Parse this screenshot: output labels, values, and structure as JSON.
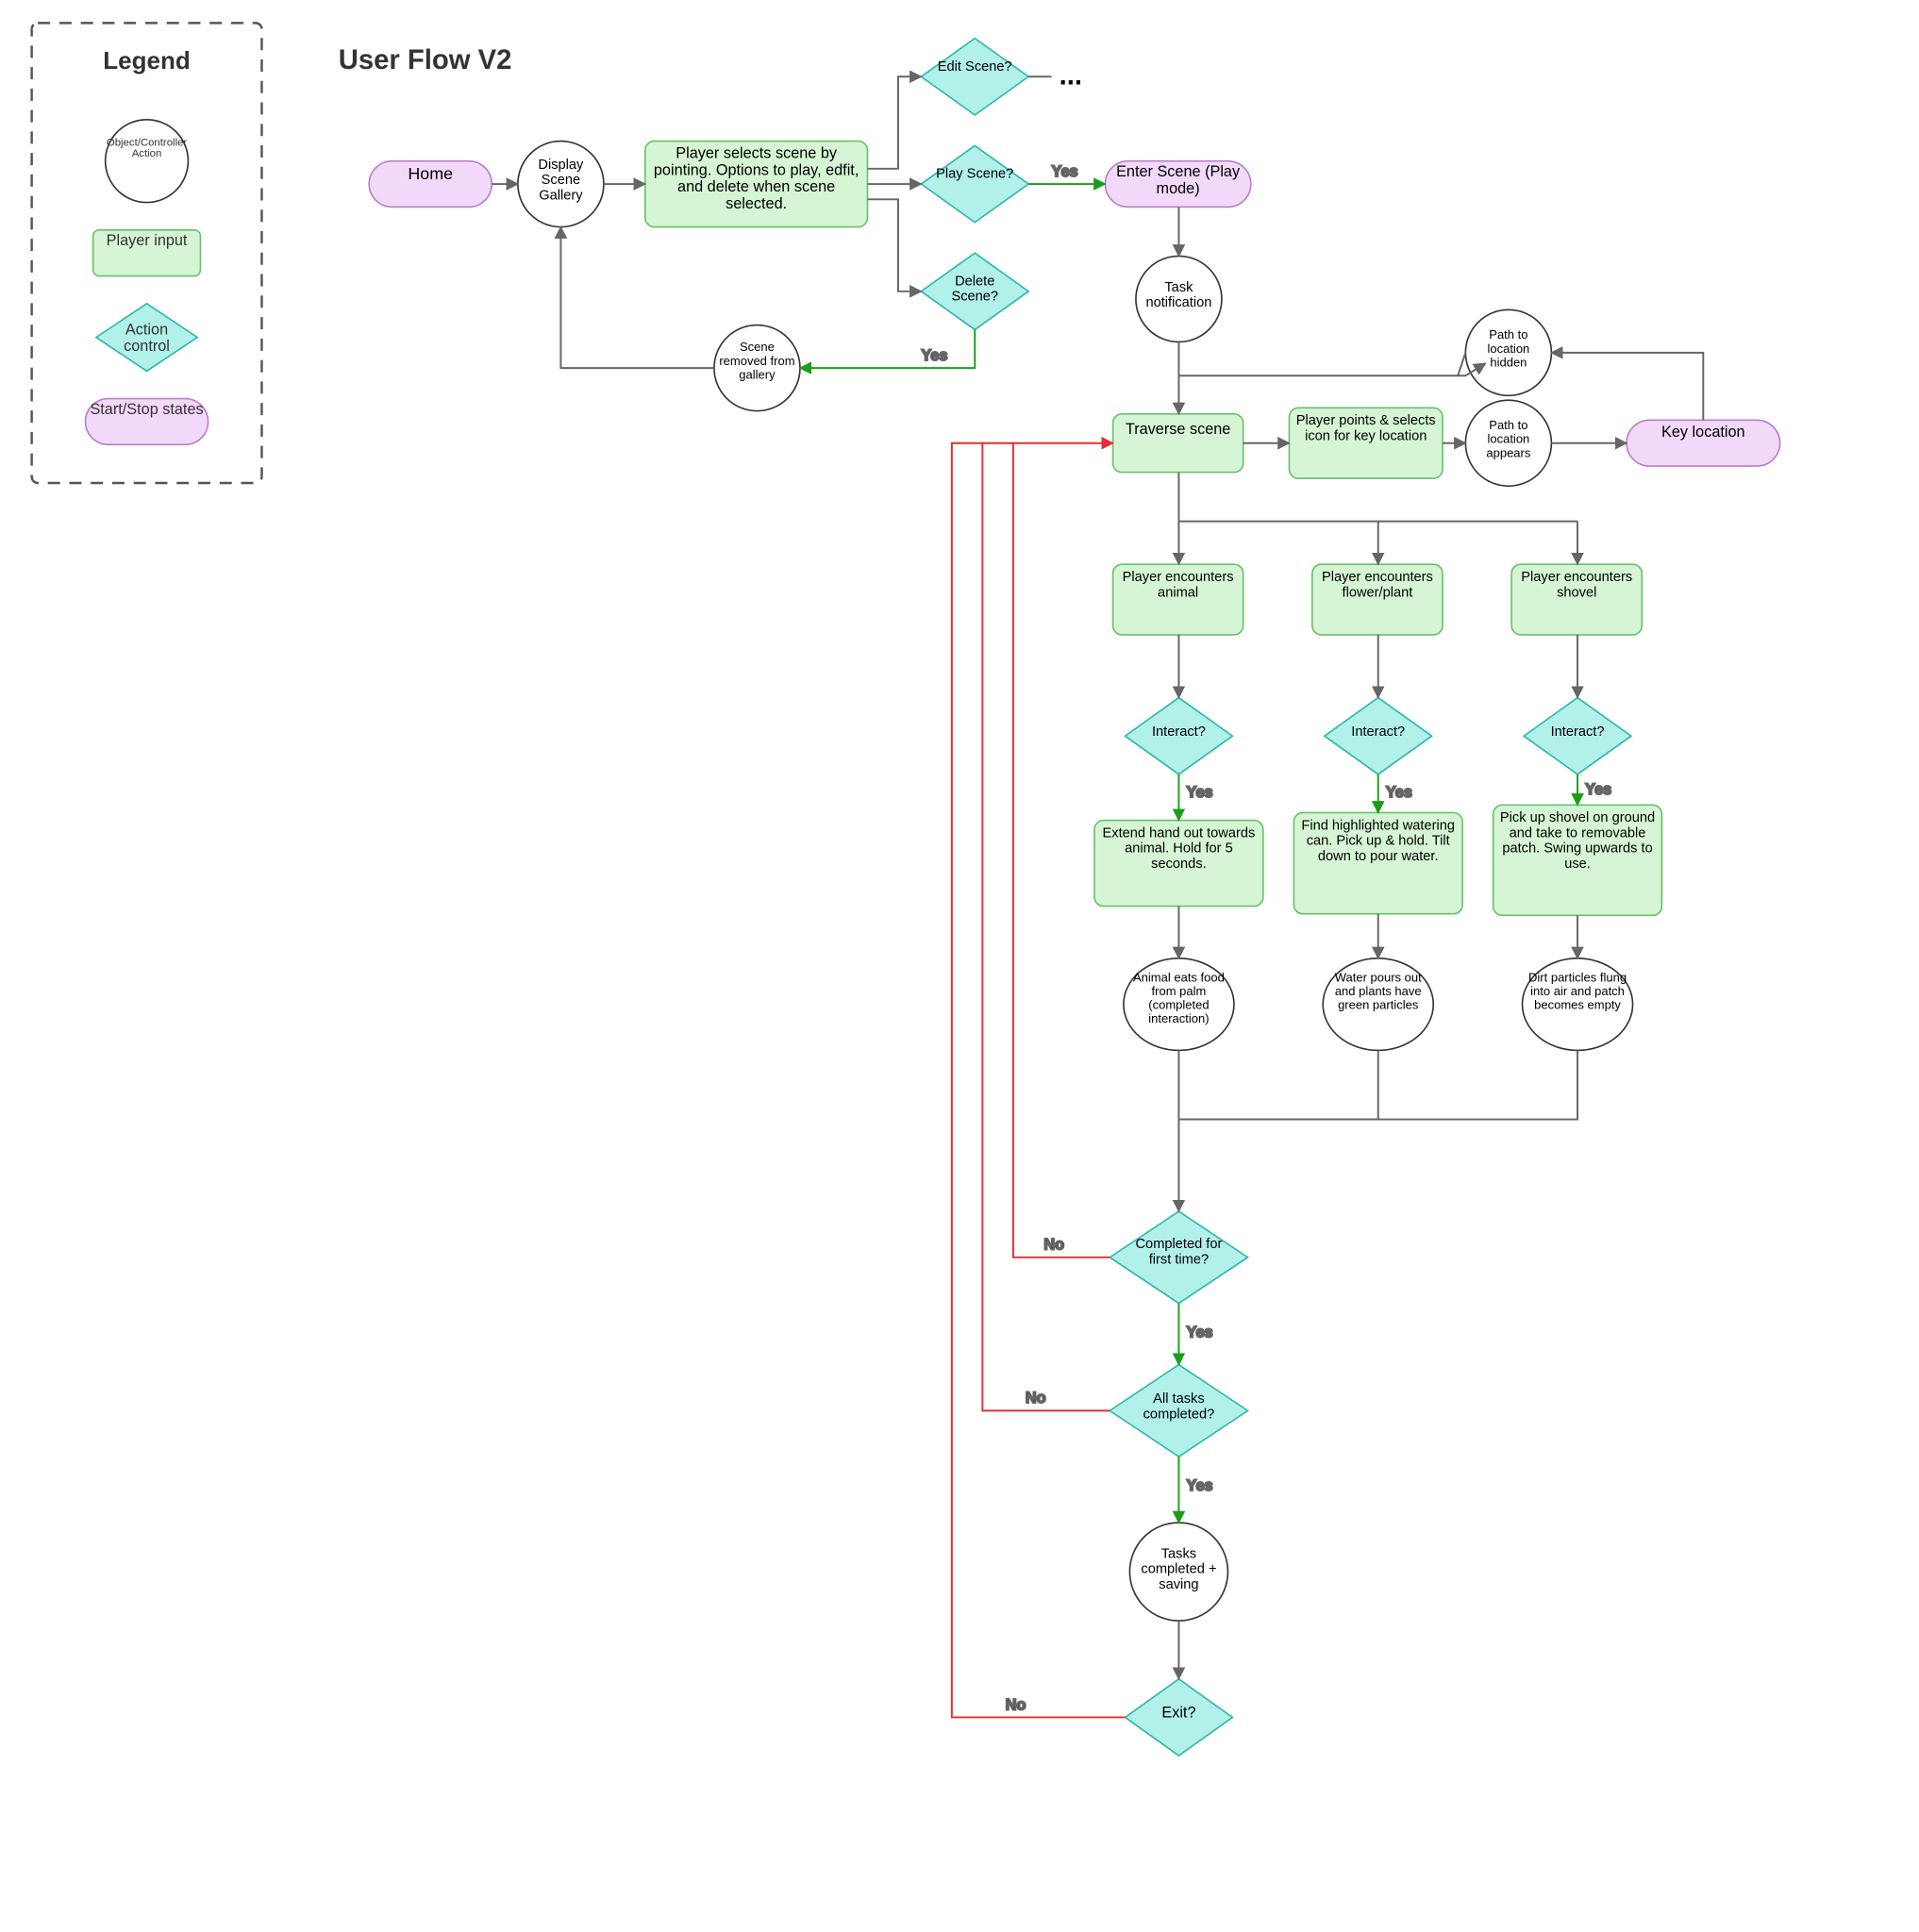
{
  "title": "User Flow V2",
  "legend": {
    "title": "Legend",
    "items": {
      "circle": "Object/Controller Action",
      "rect": "Player input",
      "diamond": "Action control",
      "pill": "Start/Stop states"
    }
  },
  "nodes": {
    "home": "Home",
    "display_gallery": "Display Scene Gallery",
    "select_scene": "Player selects scene by pointing. Options to play, edfit, and delete when scene selected.",
    "edit_scene": "Edit Scene?",
    "play_scene": "Play Scene?",
    "delete_scene": "Delete Scene?",
    "ellipsis": "...",
    "enter_scene": "Enter Scene (Play mode)",
    "scene_removed": "Scene removed from gallery",
    "task_notification": "Task notification",
    "path_hidden": "Path to location hidden",
    "traverse_scene": "Traverse scene",
    "points_icon": "Player points & selects icon for key location",
    "path_appears": "Path to location appears",
    "key_location": "Key location",
    "enc_animal": "Player encounters animal",
    "enc_flower": "Player encounters flower/plant",
    "enc_shovel": "Player encounters shovel",
    "interact1": "Interact?",
    "interact2": "Interact?",
    "interact3": "Interact?",
    "extend_hand": "Extend hand out towards animal. Hold for 5 seconds.",
    "watering_can": "Find highlighted watering can. Pick up & hold. Tilt down to pour water.",
    "shovel_action": "Pick up shovel on ground and take to removable patch. Swing upwards to use.",
    "animal_eats": "Animal eats food from palm (completed interaction)",
    "water_pours": "Water pours out and plants have green particles",
    "dirt_flies": "Dirt particles flung into air and patch becomes empty",
    "first_time": "Completed for first time?",
    "all_tasks": "All tasks completed?",
    "tasks_saving": "Tasks completed + saving",
    "exit": "Exit?"
  },
  "labels": {
    "yes": "Yes",
    "no": "No"
  },
  "colors": {
    "pill_fill": "#f3d9f9",
    "pill_stroke": "#b87fc7",
    "rect_fill": "#d5f5d5",
    "rect_stroke": "#6bbf6b",
    "diamond_fill": "#b2f0ea",
    "diamond_stroke": "#2fb7ab",
    "circle_fill": "#ffffff",
    "circle_stroke": "#333333",
    "edge": "#666666",
    "edge_yes": "#1a9e1a",
    "edge_no": "#e03030"
  }
}
